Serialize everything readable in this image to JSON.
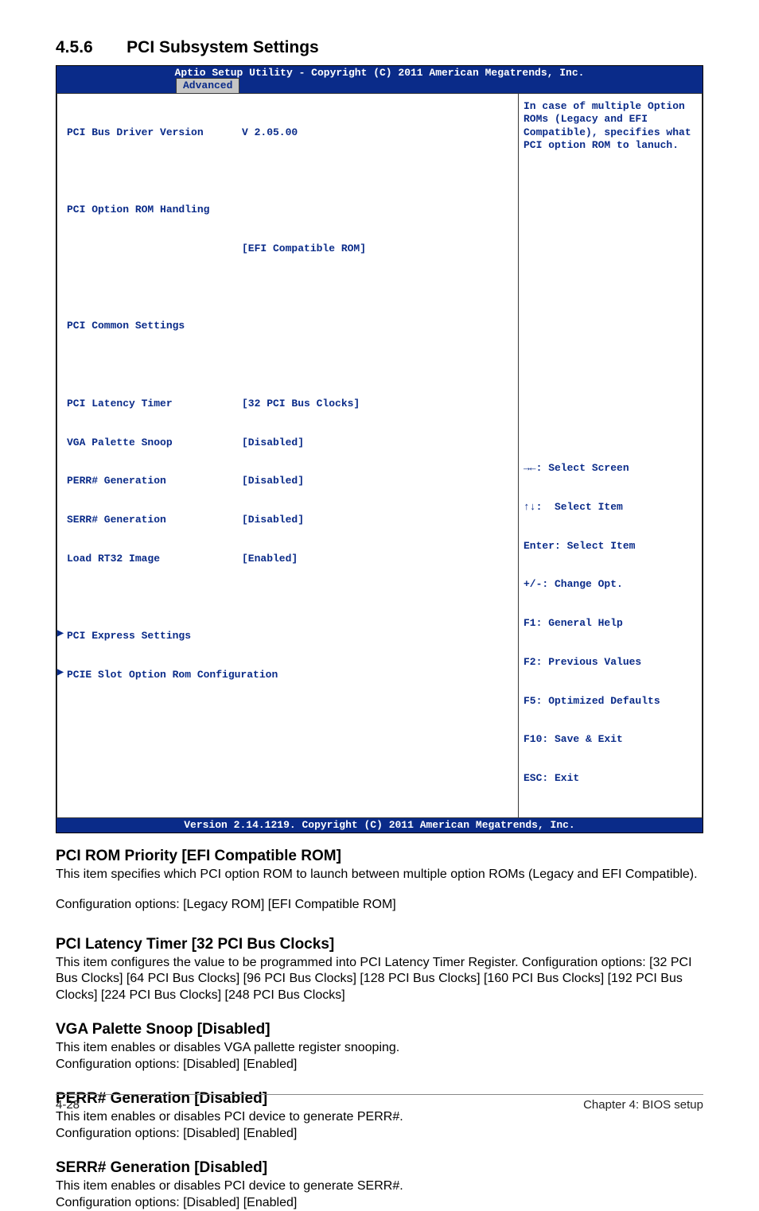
{
  "section": {
    "number": "4.5.6",
    "title": "PCI Subsystem Settings"
  },
  "bios": {
    "header": "Aptio Setup Utility - Copyright (C) 2011 American Megatrends, Inc.",
    "tab": "Advanced",
    "left": {
      "r1l": "PCI Bus Driver Version",
      "r1v": "V 2.05.00",
      "r2l": "PCI Option ROM Handling",
      "r3l": "PCI ROM Priority",
      "r3v": "[EFI Compatible ROM]",
      "r4l": "PCI Common Settings",
      "r5l": "PCI Latency Timer",
      "r5v": "[32 PCI Bus Clocks]",
      "r6l": "VGA Palette Snoop",
      "r6v": "[Disabled]",
      "r7l": "PERR# Generation",
      "r7v": "[Disabled]",
      "r8l": "SERR# Generation",
      "r8v": "[Disabled]",
      "r9l": "Load RT32 Image",
      "r9v": "[Enabled]",
      "r10": "PCI Express Settings",
      "r11": "PCIE Slot Option Rom Configuration"
    },
    "right_top": "In case of multiple Option\nROMs (Legacy and EFI\nCompatible), specifies what\nPCI option ROM to lanuch.",
    "right_bottom": {
      "l1": "→←: Select Screen",
      "l2": "↑↓:  Select Item",
      "l3": "Enter: Select Item",
      "l4": "+/-: Change Opt.",
      "l5": "F1: General Help",
      "l6": "F2: Previous Values",
      "l7": "F5: Optimized Defaults",
      "l8": "F10: Save & Exit",
      "l9": "ESC: Exit"
    },
    "footer": "Version 2.14.1219. Copyright (C) 2011 American Megatrends, Inc."
  },
  "doc": {
    "h1": "PCI ROM Priority [EFI Compatible ROM]",
    "p1": "This item specifies which PCI option ROM to launch between multiple option ROMs (Legacy and EFI Compatible).",
    "p1b": "Configuration options: [Legacy ROM] [EFI Compatible ROM]",
    "h2": "PCI Latency Timer [32 PCI Bus Clocks]",
    "p2": "This item configures the value to be programmed into PCI Latency Timer Register. Configuration options: [32 PCI Bus Clocks] [64 PCI Bus Clocks] [96 PCI Bus Clocks] [128 PCI Bus Clocks] [160 PCI Bus Clocks] [192 PCI Bus Clocks] [224 PCI Bus Clocks] [248 PCI Bus Clocks]",
    "h3": "VGA Palette Snoop [Disabled]",
    "p3": "This item enables or disables VGA pallette register snooping.\nConfiguration options: [Disabled] [Enabled]",
    "h4": "PERR# Generation [Disabled]",
    "p4": "This item enables or disables PCI device to generate PERR#.\nConfiguration options: [Disabled] [Enabled]",
    "h5": "SERR# Generation [Disabled]",
    "p5": "This item enables or disables PCI device to generate SERR#.\nConfiguration options: [Disabled] [Enabled]"
  },
  "footer": {
    "page": "4-28",
    "chapter": "Chapter 4: BIOS setup"
  }
}
